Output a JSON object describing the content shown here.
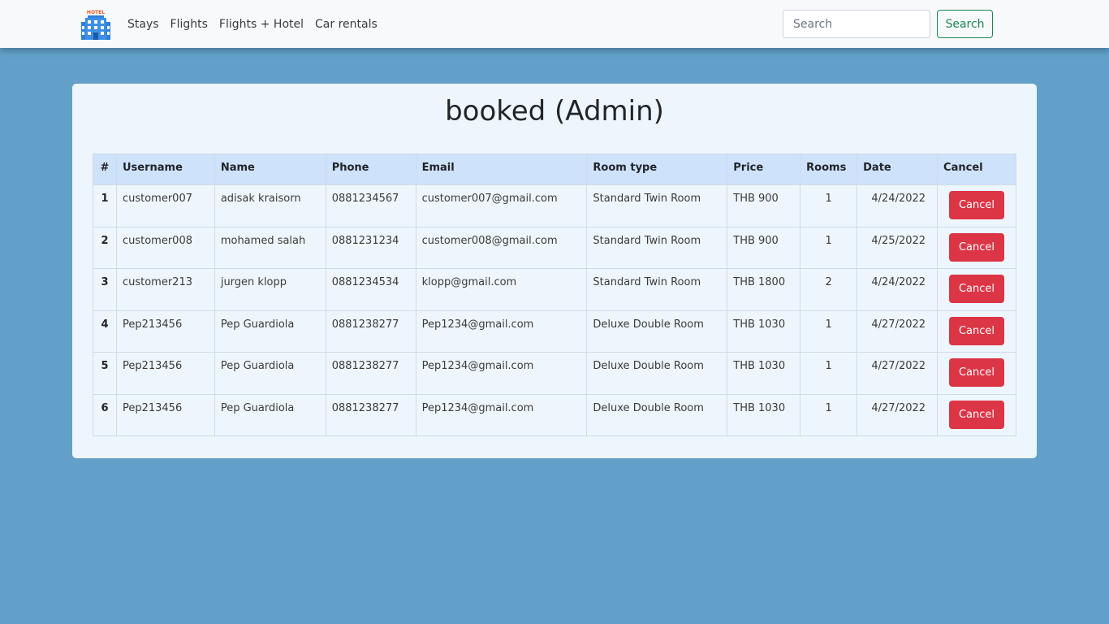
{
  "navbar": {
    "logo_icon": "hotel-building-icon",
    "logo_text": "HOTEL",
    "links": [
      "Stays",
      "Flights",
      "Flights + Hotel",
      "Car rentals"
    ],
    "search_placeholder": "Search",
    "search_button": "Search"
  },
  "page": {
    "title": "booked (Admin)"
  },
  "table": {
    "headers": [
      "#",
      "Username",
      "Name",
      "Phone",
      "Email",
      "Room type",
      "Price",
      "Rooms",
      "Date",
      "Cancel"
    ],
    "rows": [
      {
        "index": "1",
        "username": "customer007",
        "name": "adisak kraisorn",
        "phone": "0881234567",
        "email": "customer007@gmail.com",
        "room_type": "Standard Twin Room",
        "price": "THB 900",
        "rooms": "1",
        "date": "4/24/2022",
        "cancel": "Cancel"
      },
      {
        "index": "2",
        "username": "customer008",
        "name": "mohamed salah",
        "phone": "0881231234",
        "email": "customer008@gmail.com",
        "room_type": "Standard Twin Room",
        "price": "THB 900",
        "rooms": "1",
        "date": "4/25/2022",
        "cancel": "Cancel"
      },
      {
        "index": "3",
        "username": "customer213",
        "name": "jurgen klopp",
        "phone": "0881234534",
        "email": "klopp@gmail.com",
        "room_type": "Standard Twin Room",
        "price": "THB 1800",
        "rooms": "2",
        "date": "4/24/2022",
        "cancel": "Cancel"
      },
      {
        "index": "4",
        "username": "Pep213456",
        "name": "Pep Guardiola",
        "phone": "0881238277",
        "email": "Pep1234@gmail.com",
        "room_type": "Deluxe Double Room",
        "price": "THB 1030",
        "rooms": "1",
        "date": "4/27/2022",
        "cancel": "Cancel"
      },
      {
        "index": "5",
        "username": "Pep213456",
        "name": "Pep Guardiola",
        "phone": "0881238277",
        "email": "Pep1234@gmail.com",
        "room_type": "Deluxe Double Room",
        "price": "THB 1030",
        "rooms": "1",
        "date": "4/27/2022",
        "cancel": "Cancel"
      },
      {
        "index": "6",
        "username": "Pep213456",
        "name": "Pep Guardiola",
        "phone": "0881238277",
        "email": "Pep1234@gmail.com",
        "room_type": "Deluxe Double Room",
        "price": "THB 1030",
        "rooms": "1",
        "date": "4/27/2022",
        "cancel": "Cancel"
      }
    ]
  },
  "colors": {
    "background": "#62a0c9",
    "navbar": "#f8f9fa",
    "card": "#eef6fd",
    "table_header": "#cfe2fc",
    "danger": "#dc3545",
    "success": "#198754"
  }
}
